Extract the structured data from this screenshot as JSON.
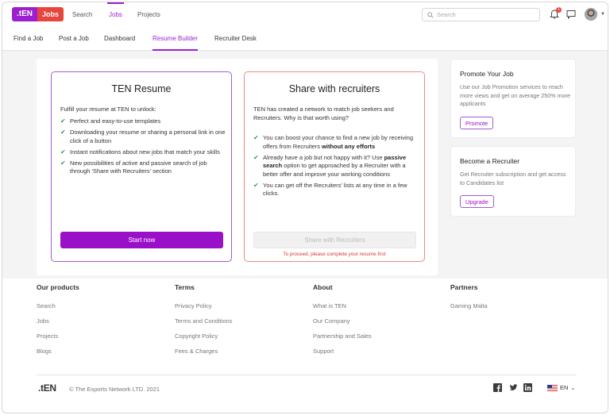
{
  "header": {
    "logo_ten": ".tEN",
    "logo_jobs": "Jobs",
    "nav": [
      "Search",
      "Jobs",
      "Projects"
    ],
    "search_placeholder": "Search",
    "notification_count": "1"
  },
  "subnav": [
    "Find a Job",
    "Post a Job",
    "Dashboard",
    "Resume Builder",
    "Recruiter Desk"
  ],
  "resume_card": {
    "title": "TEN Resume",
    "intro": "Fulfill your resume at TEN to unlock:",
    "items": [
      "Perfect and easy-to-use templates",
      "Downloading your resume or sharing a personal link in one click of a button",
      "Instant notifications about new jobs that match your skills",
      "New possibilities of active and passive search of job through 'Share with Recruiters' section"
    ],
    "button": "Start now"
  },
  "share_card": {
    "title": "Share with recruiters",
    "intro": "TEN has created a network to match job seekers and Recruiters. Why is that worth using?",
    "item1_pre": "You can boost your chance to find a new job by receiving offers from Recruiters ",
    "item1_bold": "without any efforts",
    "item2_pre": "Already have a job but not happy with it? Use ",
    "item2_bold": "passive search",
    "item2_post": " option to get approached by a Recruiter with a better offer and improve your working conditions",
    "item3": "You can get off the Recruiters' lists at any time in a few clicks.",
    "button": "Share with Recruiters",
    "warning": "To proceed, please complete your resume first"
  },
  "promote": {
    "title": "Promote Your Job",
    "text": "Use our Job Promotion services to reach more views and get on average 250% more applicants",
    "button": "Promote"
  },
  "recruiter": {
    "title": "Become a Recruiter",
    "text": "Get Recruiter subscription and get access to Candidates list",
    "button": "Upgrade"
  },
  "footer": {
    "products": {
      "title": "Our products",
      "links": [
        "Search",
        "Jobs",
        "Projects",
        "Blogs"
      ]
    },
    "terms": {
      "title": "Terms",
      "links": [
        "Privacy Policy",
        "Terms and Conditions",
        "Copyright Policy",
        "Fees & Charges"
      ]
    },
    "about": {
      "title": "About",
      "links": [
        "What is TEN",
        "Our Company",
        "Partnership and Sales",
        "Support"
      ]
    },
    "partners": {
      "title": "Partners",
      "links": [
        "Gaming Malta"
      ]
    },
    "logo": ".tEN",
    "copyright": "© The Esports Network LTD. 2021",
    "language": "EN"
  }
}
